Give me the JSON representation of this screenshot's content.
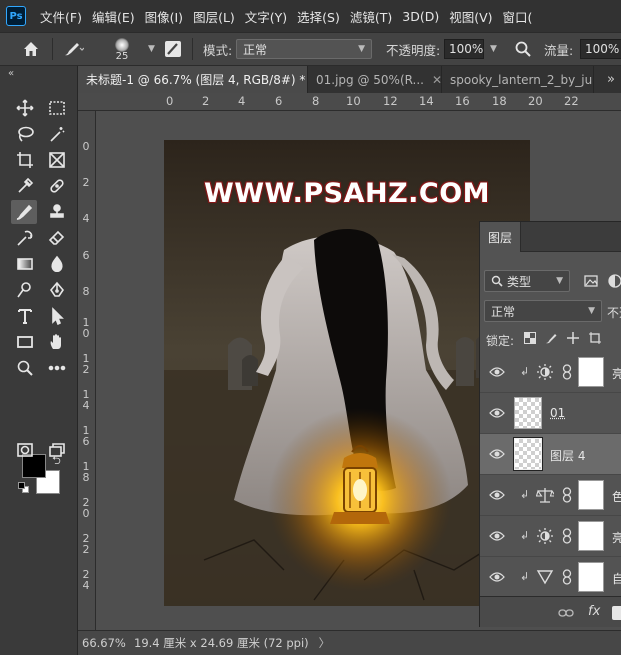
{
  "app": {
    "logo_text": "Ps"
  },
  "menu": [
    "文件(F)",
    "编辑(E)",
    "图像(I)",
    "图层(L)",
    "文字(Y)",
    "选择(S)",
    "滤镜(T)",
    "3D(D)",
    "视图(V)",
    "窗口("
  ],
  "options": {
    "brush_size": "25",
    "mode_label": "模式:",
    "mode_value": "正常",
    "opacity_label": "不透明度:",
    "opacity_value": "100%",
    "flow_label": "流量:",
    "flow_value": "100%"
  },
  "tabs": [
    {
      "label": "未标题-1 @ 66.7% (图层 4, RGB/8#) *",
      "active": true
    },
    {
      "label": "01.jpg @ 50%(R...",
      "active": false
    },
    {
      "label": "spooky_lantern_2_by_ju",
      "active": false
    }
  ],
  "tab_more": "»",
  "ruler": {
    "top": [
      "0",
      "2",
      "4",
      "6",
      "8",
      "10",
      "12",
      "14",
      "16",
      "18",
      "20",
      "22"
    ],
    "left": [
      "0",
      "2",
      "4",
      "6",
      "8",
      "10",
      "12",
      "14",
      "16",
      "18",
      "20",
      "22",
      "24"
    ]
  },
  "canvas": {
    "watermark": "WWW.PSAHZ.COM"
  },
  "status": {
    "zoom": "66.67%",
    "doc_info": "19.4 厘米 x 24.69 厘米 (72 ppi)",
    "arrow": "〉"
  },
  "layers_panel": {
    "tab_label": "图层",
    "filter_kind": "类型",
    "blend_mode": "正常",
    "opacity_label": "不透",
    "lock_label": "锁定:",
    "layers": [
      {
        "name": "亮",
        "kind": "adjustment",
        "adj_icon": "brightness-icon",
        "clipped": true,
        "selected": false
      },
      {
        "name": "01",
        "kind": "pixel",
        "clipped": false,
        "selected": false
      },
      {
        "name": "图层 4",
        "kind": "pixel",
        "clipped": false,
        "selected": true
      },
      {
        "name": "色",
        "kind": "adjustment",
        "adj_icon": "balance-icon",
        "clipped": true,
        "selected": false
      },
      {
        "name": "亮",
        "kind": "adjustment",
        "adj_icon": "brightness-icon",
        "clipped": true,
        "selected": false
      },
      {
        "name": "自",
        "kind": "adjustment",
        "adj_icon": "levels-icon",
        "clipped": true,
        "selected": false
      }
    ],
    "footer_fx": "fx"
  },
  "colors": {
    "foreground": "#000000",
    "background": "#ffffff",
    "accent": "#31a8ff"
  }
}
